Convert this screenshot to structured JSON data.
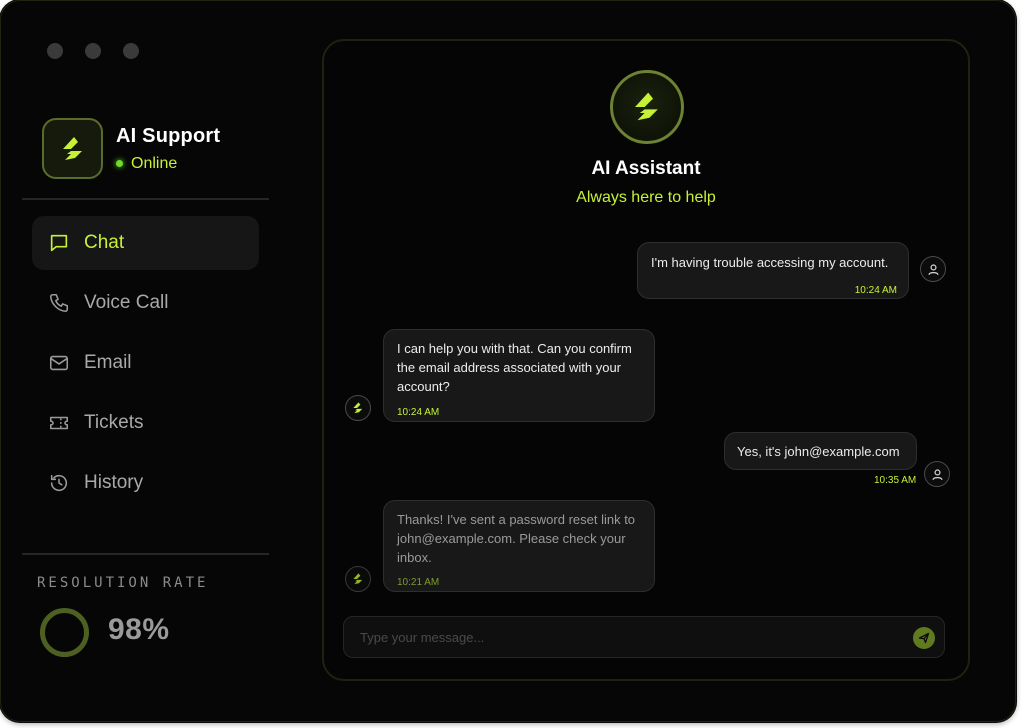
{
  "sidebar": {
    "name": "AI Support",
    "status": "Online",
    "nav": [
      {
        "label": "Chat",
        "icon": "chat-icon",
        "active": true
      },
      {
        "label": "Voice Call",
        "icon": "phone-icon",
        "active": false
      },
      {
        "label": "Email",
        "icon": "mail-icon",
        "active": false
      },
      {
        "label": "Tickets",
        "icon": "ticket-icon",
        "active": false
      },
      {
        "label": "History",
        "icon": "history-icon",
        "active": false
      }
    ],
    "resolution_label": "RESOLUTION RATE",
    "resolution_value": "98%"
  },
  "chat": {
    "title": "AI Assistant",
    "subtitle": "Always here to help",
    "messages": [
      {
        "from": "user",
        "text": "I'm having trouble accessing my account.",
        "time": "10:24 AM"
      },
      {
        "from": "bot",
        "text": "I can help you with that. Can you confirm the email address associated with your account?",
        "time": "10:24 AM"
      },
      {
        "from": "user",
        "text": "Yes, it's john@example.com",
        "time": "10:35 AM"
      },
      {
        "from": "bot",
        "text": "Thanks! I've sent a password reset link to john@example.com. Please check your inbox.",
        "time": "10:21 AM"
      }
    ],
    "input_placeholder": "Type your message..."
  },
  "colors": {
    "accent": "#c6f135",
    "background": "#060606",
    "online": "#6fdc2a"
  }
}
